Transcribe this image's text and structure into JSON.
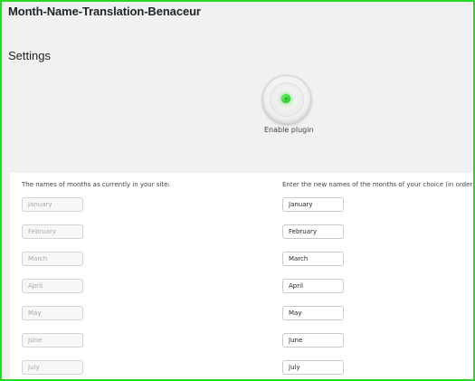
{
  "plugin": {
    "title": "Month-Name-Translation-Benaceur"
  },
  "settings": {
    "heading": "Settings",
    "enable_label": "Enable plugin",
    "enabled": true
  },
  "columns": {
    "current_label": "The names of months as currently in your site:",
    "new_label": "Enter the new names of the months of your choice (in order):"
  },
  "months": [
    {
      "current": "January",
      "new": "January"
    },
    {
      "current": "February",
      "new": "February"
    },
    {
      "current": "March",
      "new": "March"
    },
    {
      "current": "April",
      "new": "April"
    },
    {
      "current": "May",
      "new": "May"
    },
    {
      "current": "June",
      "new": "June"
    },
    {
      "current": "July",
      "new": "July"
    }
  ],
  "colors": {
    "border": "#27d827",
    "led": "#2bd62b",
    "background": "#f1f1f1"
  }
}
